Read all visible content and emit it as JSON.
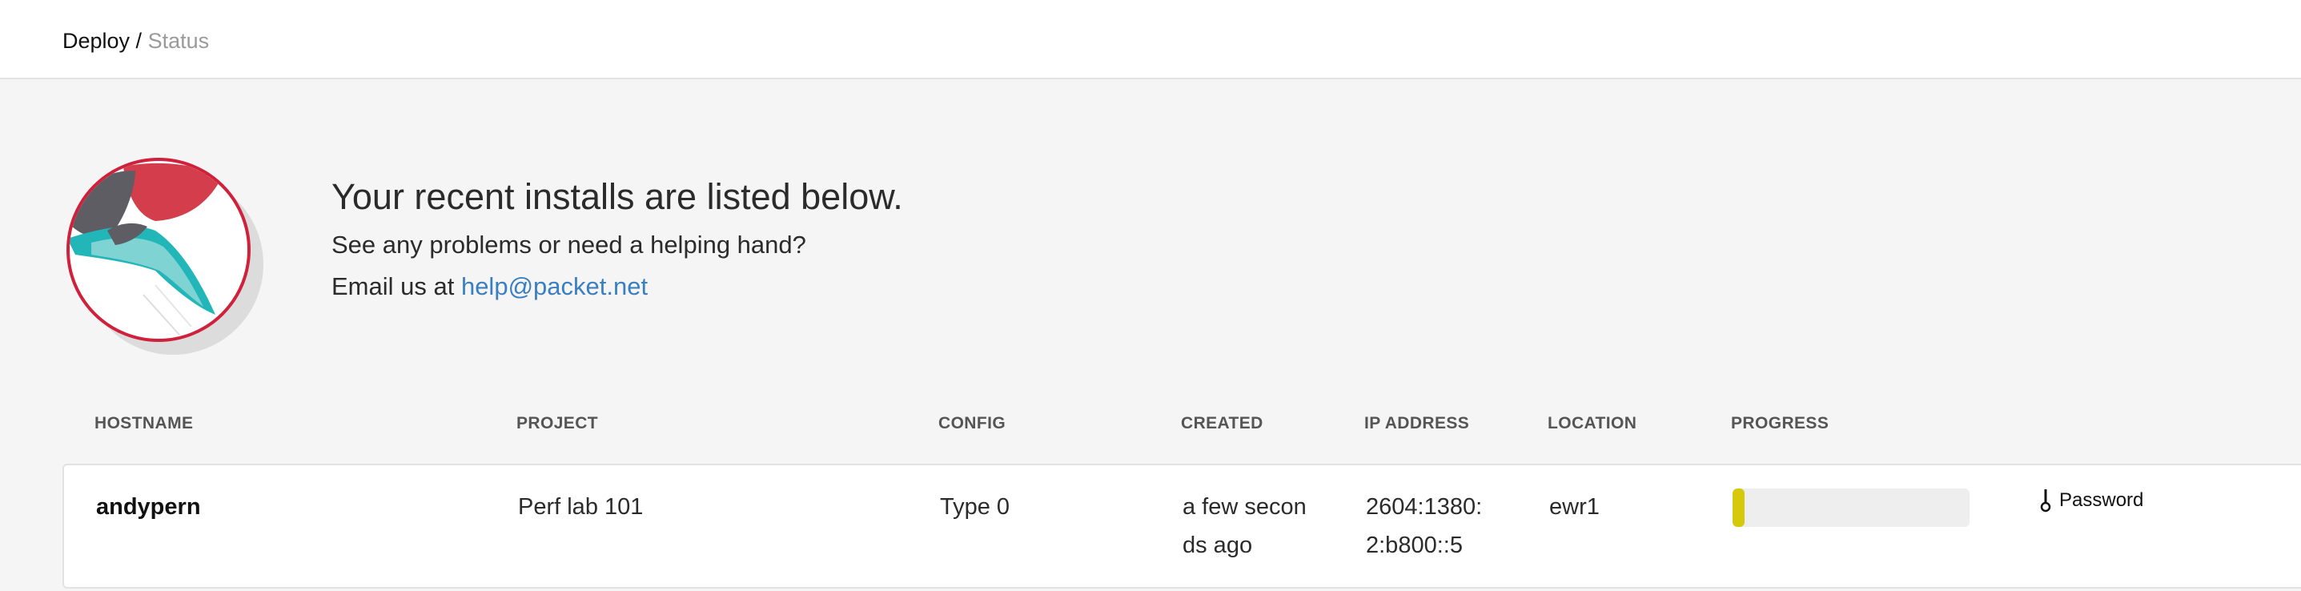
{
  "breadcrumb": {
    "root": "Deploy",
    "separator": " / ",
    "current": "Status"
  },
  "hero": {
    "title": "Your recent installs are listed below.",
    "line1": "See any problems or need a helping hand?",
    "line2_prefix": "Email us at ",
    "email": "help@packet.net",
    "logo_icon": "packet-bird-logo-icon"
  },
  "table": {
    "headers": {
      "hostname": "HOSTNAME",
      "project": "PROJECT",
      "config": "CONFIG",
      "created": "CREATED",
      "ip": "IP ADDRESS",
      "location": "LOCATION",
      "progress": "PROGRESS"
    },
    "rows": [
      {
        "hostname": "andypern",
        "project": "Perf lab 101",
        "config": "Type 0",
        "created_line1": "a few secon",
        "created_line2": "ds ago",
        "ip_line1": "2604:1380:",
        "ip_line2": "2:b800::5",
        "location": "ewr1",
        "progress_percent": 5,
        "password_label": "Password",
        "password_icon": "key-icon"
      }
    ]
  },
  "colors": {
    "accent_link": "#3a7fc1",
    "progress_fill": "#d6c90b",
    "logo_ring": "#d0213c"
  }
}
